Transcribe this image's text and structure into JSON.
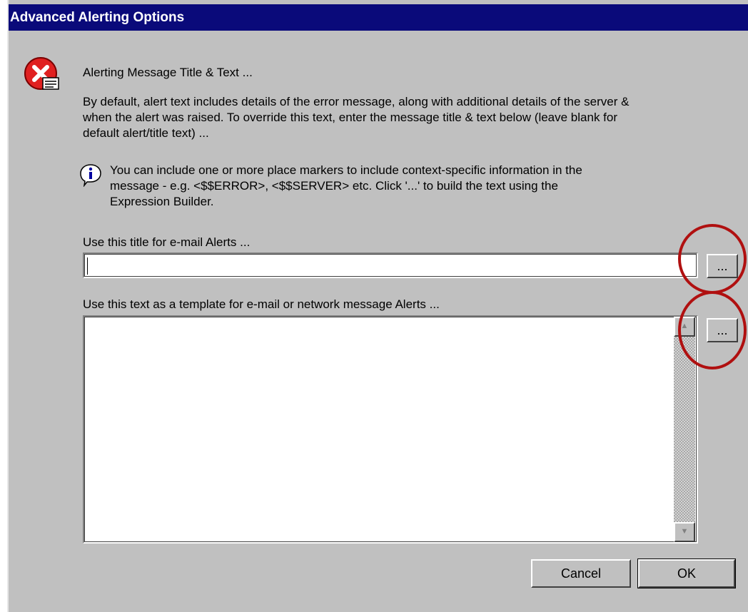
{
  "window": {
    "title": "Advanced Alerting Options"
  },
  "header": {
    "heading": "Alerting Message Title & Text ..."
  },
  "description": {
    "line1": "By default, alert text includes details of the error message, along with additional details of the server &",
    "line2": "when the alert was raised. To override this text, enter the message title & text below (leave blank for",
    "line3": "default alert/title text) ..."
  },
  "info": {
    "line1": "You can include one or more place markers to include context-specific information in the",
    "line2": "message - e.g. <$$ERROR>, <$$SERVER> etc. Click '...' to build the text using the",
    "line3": "Expression Builder."
  },
  "title_field": {
    "label": "Use this title for e-mail Alerts ...",
    "value": "",
    "builder_label": "..."
  },
  "text_field": {
    "label": "Use this text as a template for e-mail or network message Alerts ...",
    "value": "",
    "builder_label": "..."
  },
  "buttons": {
    "cancel": "Cancel",
    "ok": "OK"
  },
  "icons": {
    "error": "error-icon",
    "info": "info-icon",
    "scroll_up": "arrow-up-icon",
    "scroll_down": "arrow-down-icon"
  },
  "colors": {
    "titlebar": "#0a0a7a",
    "dialog_bg": "#c0c0c0",
    "highlight_circles": "#b01010",
    "error_icon": "#e02020"
  }
}
